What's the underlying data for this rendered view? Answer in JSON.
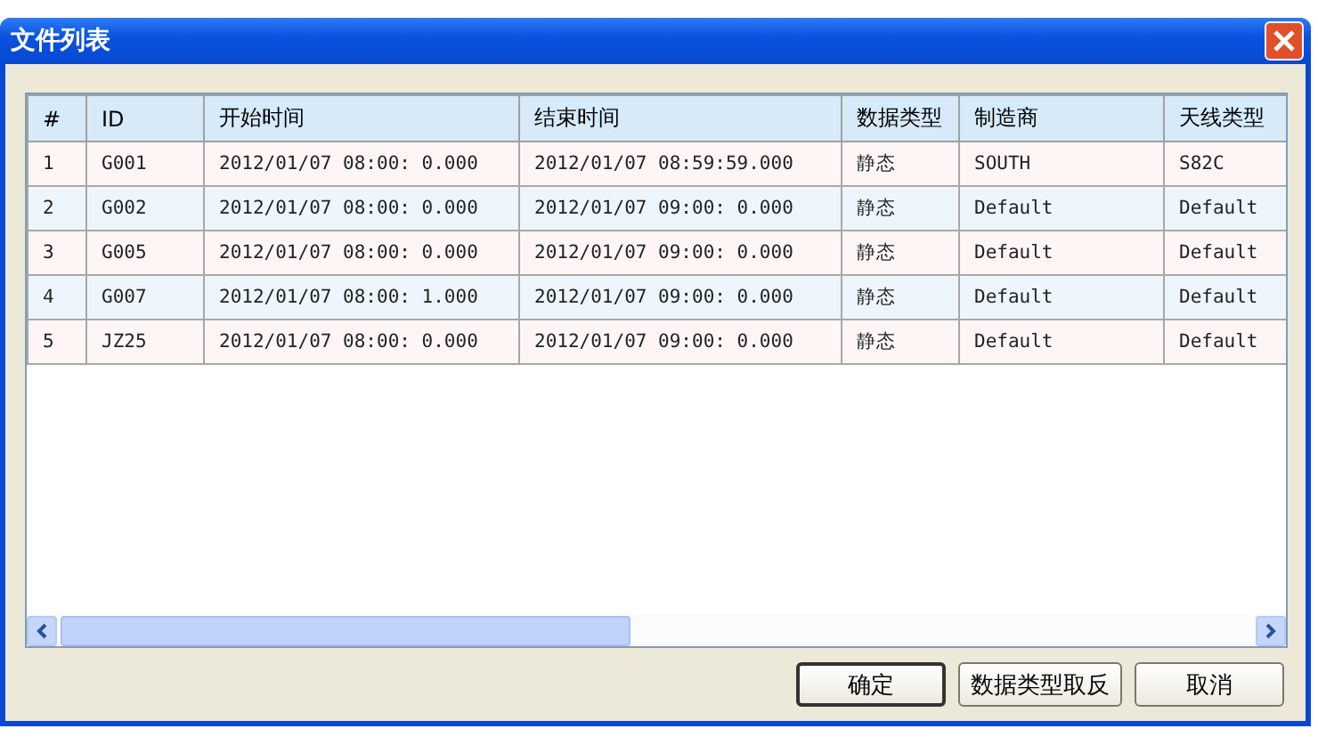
{
  "window": {
    "title": "文件列表"
  },
  "table": {
    "columns": [
      "#",
      "ID",
      "开始时间",
      "结束时间",
      "数据类型",
      "制造商",
      "天线类型"
    ],
    "rows": [
      [
        "1",
        "G001",
        "2012/01/07 08:00: 0.000",
        "2012/01/07 08:59:59.000",
        "静态",
        "SOUTH",
        "S82C"
      ],
      [
        "2",
        "G002",
        "2012/01/07 08:00: 0.000",
        "2012/01/07 09:00: 0.000",
        "静态",
        "Default",
        "Default"
      ],
      [
        "3",
        "G005",
        "2012/01/07 08:00: 0.000",
        "2012/01/07 09:00: 0.000",
        "静态",
        "Default",
        "Default"
      ],
      [
        "4",
        "G007",
        "2012/01/07 08:00: 1.000",
        "2012/01/07 09:00: 0.000",
        "静态",
        "Default",
        "Default"
      ],
      [
        "5",
        "JZ25",
        "2012/01/07 08:00: 0.000",
        "2012/01/07 09:00: 0.000",
        "静态",
        "Default",
        "Default"
      ]
    ]
  },
  "buttons": [
    "确定",
    "数据类型取反",
    "取消"
  ]
}
